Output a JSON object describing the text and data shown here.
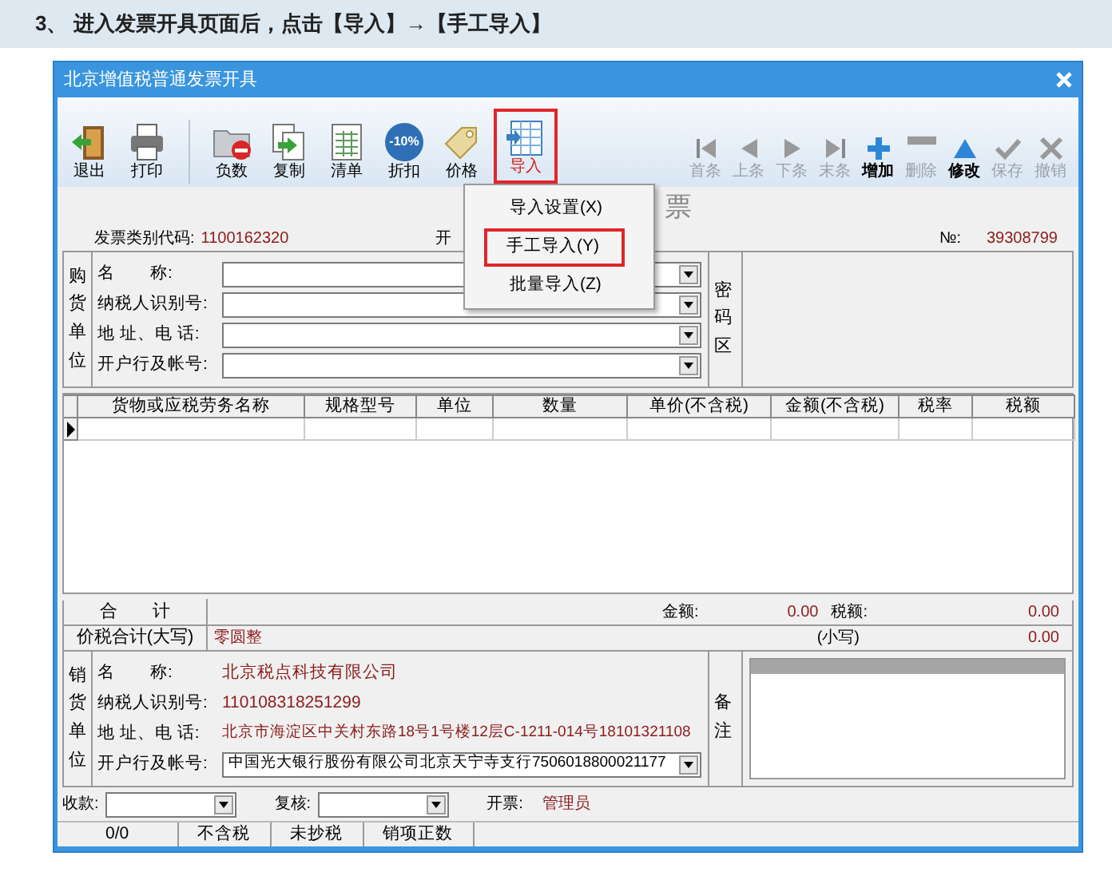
{
  "instruction": "3、 进入发票开具页面后，点击【导入】→【手工导入】",
  "window": {
    "title": "北京增值税普通发票开具"
  },
  "toolbar_left": [
    {
      "label": "退出",
      "kind": "exit",
      "highlighted": false
    },
    {
      "label": "打印",
      "kind": "print",
      "highlighted": false
    },
    {
      "label": "负数",
      "kind": "negative",
      "highlighted": false
    },
    {
      "label": "复制",
      "kind": "copy",
      "highlighted": false
    },
    {
      "label": "清单",
      "kind": "list",
      "highlighted": false
    },
    {
      "label": "折扣",
      "kind": "discount",
      "highlighted": false,
      "icon_text": "-10%"
    },
    {
      "label": "价格",
      "kind": "price",
      "highlighted": false
    },
    {
      "label": "导入",
      "kind": "import",
      "highlighted": true
    }
  ],
  "toolbar_right": [
    {
      "label": "首条",
      "kind": "first",
      "disabled": true
    },
    {
      "label": "上条",
      "kind": "prev",
      "disabled": true
    },
    {
      "label": "下条",
      "kind": "next",
      "disabled": true
    },
    {
      "label": "末条",
      "kind": "last",
      "disabled": true
    },
    {
      "label": "增加",
      "kind": "add",
      "disabled": false
    },
    {
      "label": "删除",
      "kind": "delete",
      "disabled": true
    },
    {
      "label": "修改",
      "kind": "edit",
      "disabled": false
    },
    {
      "label": "保存",
      "kind": "save",
      "disabled": true
    },
    {
      "label": "撤销",
      "kind": "undo",
      "disabled": true
    }
  ],
  "menu": [
    {
      "label": "导入设置(X)",
      "highlighted": false
    },
    {
      "label": "手工导入(Y)",
      "highlighted": true
    },
    {
      "label": "批量导入(Z)",
      "highlighted": false
    }
  ],
  "invoice_title_fragments": [
    "票"
  ],
  "header": {
    "code_label": "发票类别代码:",
    "code": "1100162320",
    "date_label_fragment": "开",
    "number_label": "№:",
    "number": "39308799"
  },
  "buyer": {
    "section_label": "购货单位",
    "fields": [
      {
        "label": "名　　称:"
      },
      {
        "label": "纳税人识别号:"
      },
      {
        "label": "地 址、电 话:"
      },
      {
        "label": "开户行及帐号:"
      }
    ],
    "password_label": "密码区"
  },
  "table": {
    "columns": [
      "货物或应税劳务名称",
      "规格型号",
      "单位",
      "数量",
      "单价(不含税)",
      "金额(不含税)",
      "税率",
      "税额"
    ]
  },
  "totals": {
    "label": "合　　计",
    "amount_label": "金额:",
    "amount": "0.00",
    "tax_label": "税额:",
    "tax": "0.00"
  },
  "total_in_words": {
    "label": "价税合计(大写)",
    "words": "零圆整",
    "small_label": "(小写)",
    "small": "0.00"
  },
  "seller": {
    "section_label": "销货单位",
    "fields": [
      {
        "label": "名　　称:",
        "value": "北京税点科技有限公司",
        "kind": "text"
      },
      {
        "label": "纳税人识别号:",
        "value": "110108318251299",
        "kind": "text"
      },
      {
        "label": "地 址、电 话:",
        "value": "北京市海淀区中关村东路18号1号楼12层C-1211-014号18101321108",
        "kind": "text"
      },
      {
        "label": "开户行及帐号:",
        "value": "中国光大银行股份有限公司北京天宁寺支行7506018800021177",
        "kind": "select"
      }
    ],
    "remarks_label": "备注"
  },
  "signers": [
    {
      "label": "收款:",
      "kind": "select"
    },
    {
      "label": "复核:",
      "kind": "select"
    },
    {
      "label": "开票:",
      "kind": "text",
      "value": "管理员"
    }
  ],
  "status_bar": [
    "0/0",
    "不含税",
    "未抄税",
    "销项正数"
  ]
}
